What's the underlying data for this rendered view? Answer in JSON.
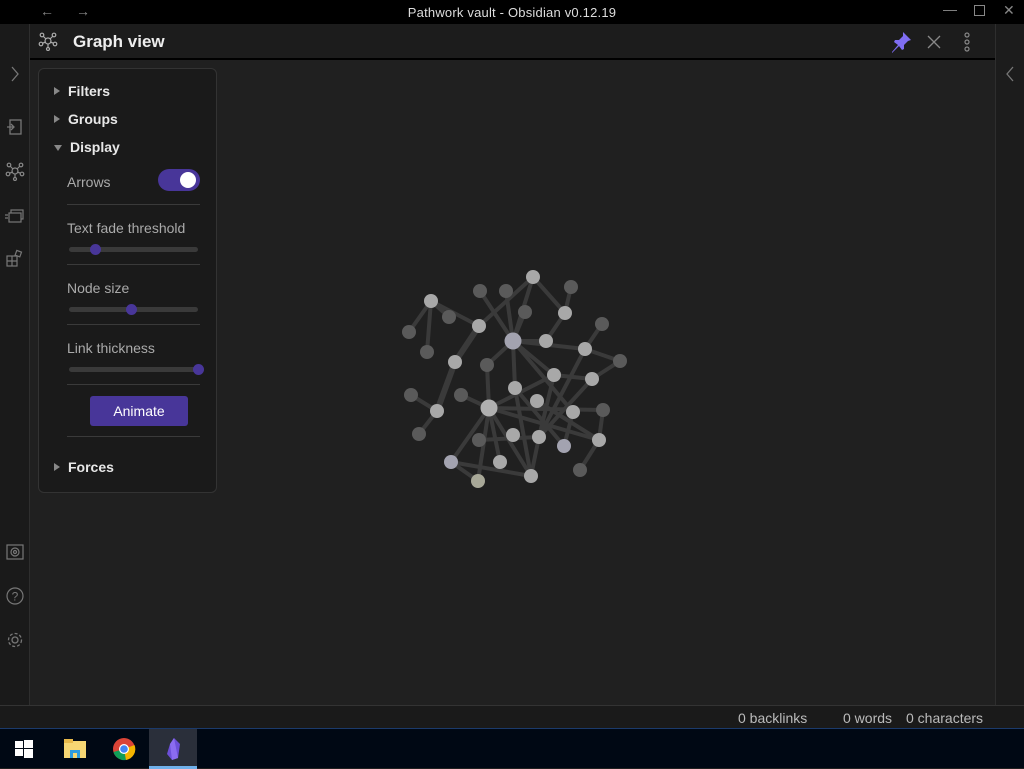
{
  "window": {
    "title": "Pathwork vault - Obsidian v0.12.19"
  },
  "header": {
    "title": "Graph view"
  },
  "panel": {
    "filters": "Filters",
    "groups": "Groups",
    "display": "Display",
    "forces": "Forces",
    "arrows_label": "Arrows",
    "arrows_on": true,
    "text_fade_label": "Text fade threshold",
    "text_fade_value": 0.2,
    "node_size_label": "Node size",
    "node_size_value": 0.48,
    "link_thickness_label": "Link thickness",
    "link_thickness_value": 1.0,
    "animate_label": "Animate"
  },
  "status": {
    "backlinks": "0 backlinks",
    "words": "0 words",
    "characters": "0 characters"
  },
  "colors": {
    "accent": "#483699",
    "pin": "#7f6df2"
  }
}
